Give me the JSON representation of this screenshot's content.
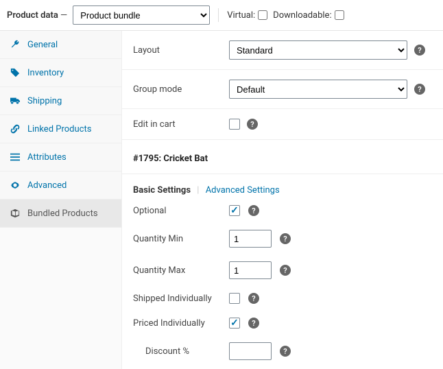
{
  "header": {
    "title": "Product data",
    "product_type": "Product bundle",
    "virtual_label": "Virtual:",
    "virtual_checked": false,
    "downloadable_label": "Downloadable:",
    "downloadable_checked": false
  },
  "sidebar": {
    "items": [
      {
        "label": "General",
        "icon": "wrench"
      },
      {
        "label": "Inventory",
        "icon": "tag"
      },
      {
        "label": "Shipping",
        "icon": "truck"
      },
      {
        "label": "Linked Products",
        "icon": "link"
      },
      {
        "label": "Attributes",
        "icon": "list"
      },
      {
        "label": "Advanced",
        "icon": "gear"
      },
      {
        "label": "Bundled Products",
        "icon": "box"
      }
    ],
    "active_index": 6
  },
  "main": {
    "layout": {
      "label": "Layout",
      "value": "Standard"
    },
    "group_mode": {
      "label": "Group mode",
      "value": "Default"
    },
    "edit_in_cart": {
      "label": "Edit in cart",
      "checked": false
    },
    "bundled_item": {
      "title": "#1795: Cricket Bat",
      "tabs": {
        "basic": "Basic Settings",
        "advanced": "Advanced Settings"
      },
      "fields": {
        "optional": {
          "label": "Optional",
          "checked": true
        },
        "qty_min": {
          "label": "Quantity Min",
          "value": "1"
        },
        "qty_max": {
          "label": "Quantity Max",
          "value": "1"
        },
        "shipped_ind": {
          "label": "Shipped Individually",
          "checked": false
        },
        "priced_ind": {
          "label": "Priced Individually",
          "checked": true
        },
        "discount": {
          "label": "Discount %",
          "value": ""
        }
      }
    }
  }
}
